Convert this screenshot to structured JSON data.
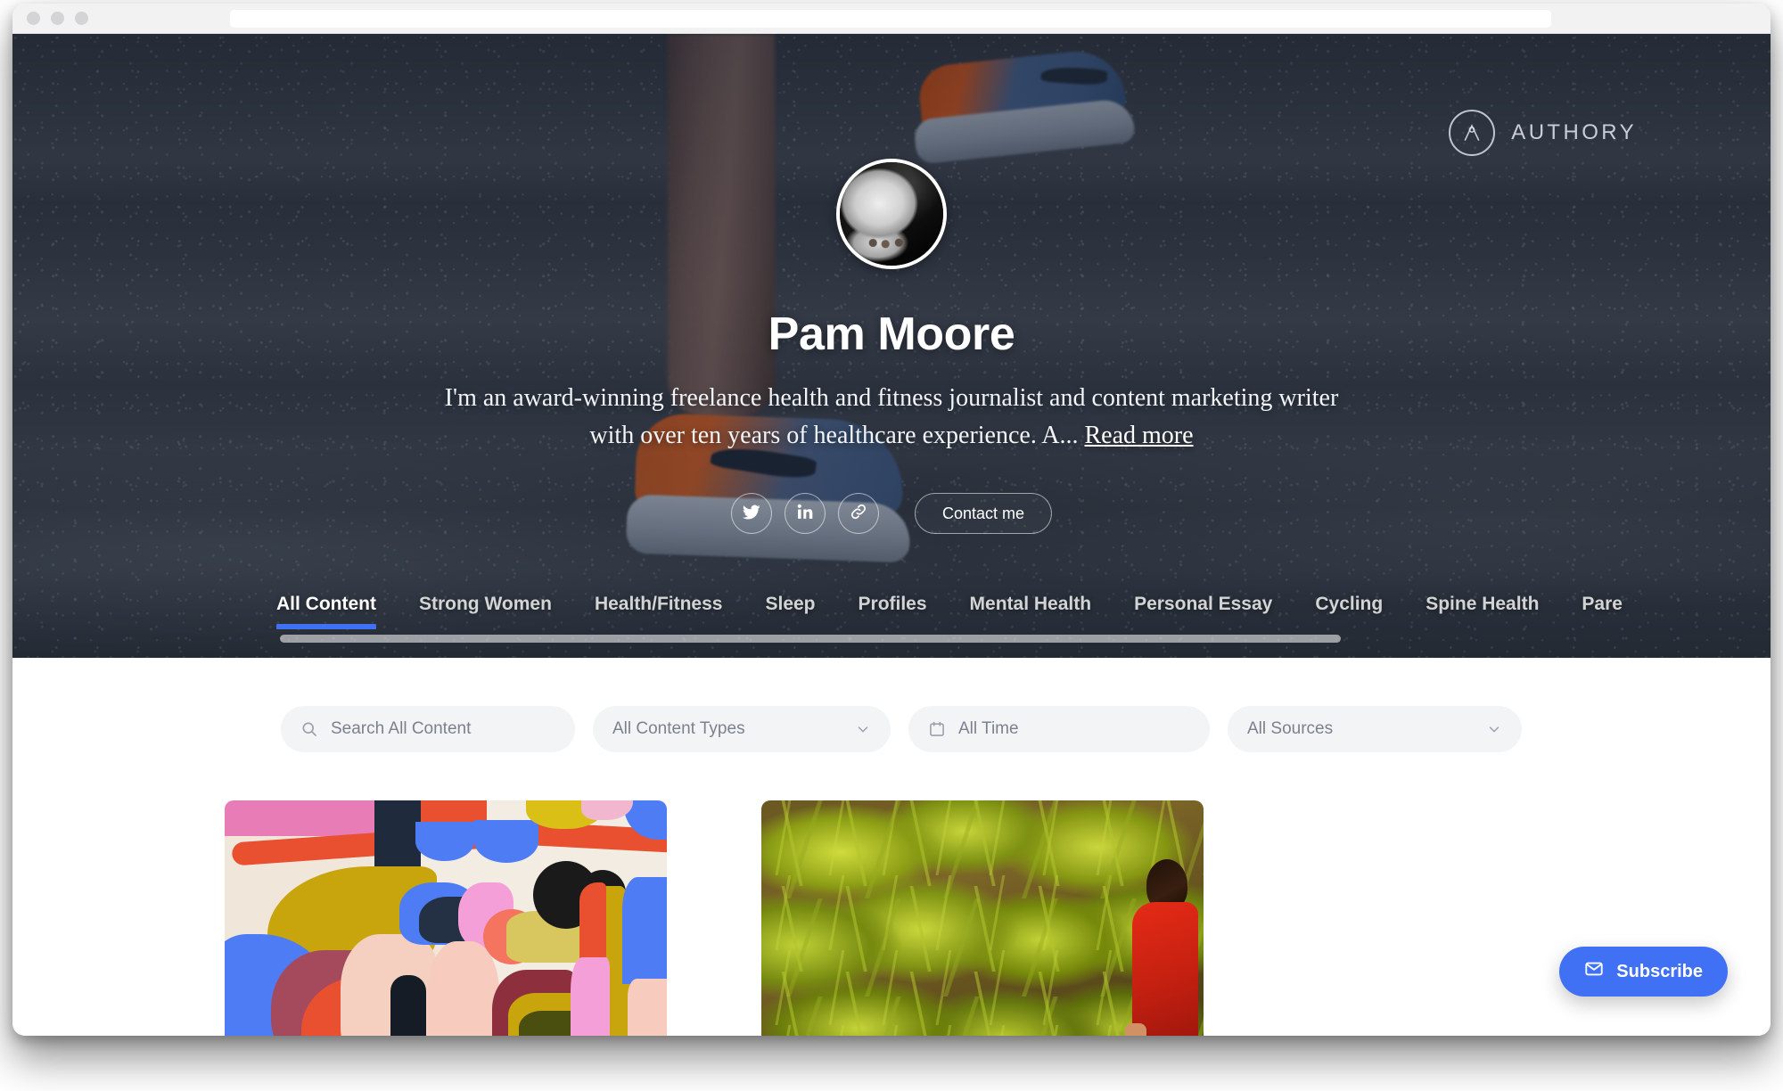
{
  "theme": {
    "accent": "#4070F4",
    "panel_bg": "#FFFFFF",
    "field_bg": "#F3F4F6",
    "hero_tint": "#2B3445"
  },
  "browser": {
    "address_value": "",
    "traffic_lights": [
      "close-dot",
      "minimize-dot",
      "maximize-dot"
    ]
  },
  "brand": {
    "wordmark": "AUTHORY",
    "logo_icon": "authory-circle-a-logo"
  },
  "profile": {
    "avatar_alt": "Pam Moore portrait",
    "name": "Pam Moore",
    "bio_text": "I'm an award-winning freelance health and fitness journalist and content marketing writer with over ten years of healthcare experience. A...",
    "read_more_label": "Read more",
    "social": [
      {
        "name": "twitter",
        "icon": "twitter-icon"
      },
      {
        "name": "linkedin",
        "icon": "linkedin-icon"
      },
      {
        "name": "website",
        "icon": "link-icon"
      }
    ],
    "contact_label": "Contact me"
  },
  "nav": {
    "active_index": 0,
    "items": [
      {
        "label": "All Content"
      },
      {
        "label": "Strong Women"
      },
      {
        "label": "Health/Fitness"
      },
      {
        "label": "Sleep"
      },
      {
        "label": "Profiles"
      },
      {
        "label": "Mental Health"
      },
      {
        "label": "Personal Essay"
      },
      {
        "label": "Cycling"
      },
      {
        "label": "Spine Health"
      },
      {
        "label": "Pare"
      }
    ]
  },
  "filters": {
    "search_placeholder": "Search All Content",
    "search_value": "",
    "search_icon": "search-icon",
    "content_types_label": "All Content Types",
    "time_label": "All Time",
    "time_icon": "calendar-icon",
    "sources_label": "All Sources",
    "chevron_icon": "chevron-down-icon"
  },
  "cards": [
    {
      "name": "abstract-illustration-card",
      "alt": "Colorful abstract illustration of stretching figures"
    },
    {
      "name": "agave-field-card",
      "alt": "Person in red jacket walking through a field of agave plants"
    }
  ],
  "subscribe": {
    "label": "Subscribe",
    "icon": "envelope-icon"
  }
}
